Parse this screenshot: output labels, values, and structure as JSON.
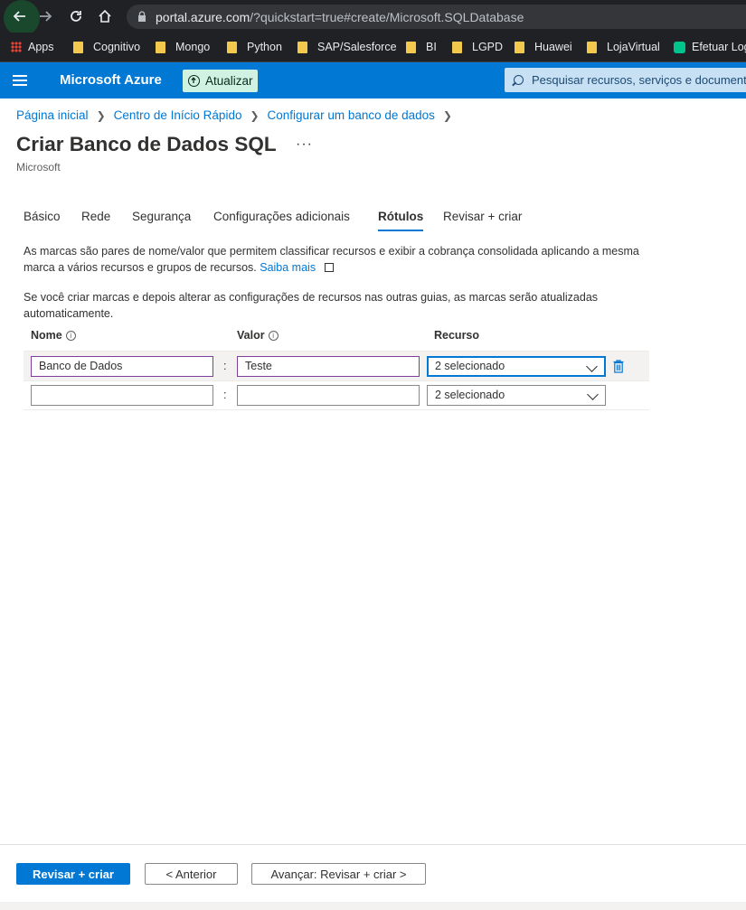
{
  "browser": {
    "url_domain": "portal.azure.com",
    "url_path": "/?quickstart=true#create/Microsoft.SQLDatabase",
    "bookmarks": [
      "Apps",
      "Cognitivo",
      "Mongo",
      "Python",
      "SAP/Salesforce",
      "BI",
      "LGPD",
      "Huawei",
      "LojaVirtual",
      "Efetuar Log"
    ]
  },
  "header": {
    "brand": "Microsoft Azure",
    "update_label": "Atualizar",
    "search_placeholder": "Pesquisar recursos, serviços e documentos"
  },
  "breadcrumb": [
    "Página inicial",
    "Centro de Início Rápido",
    "Configurar um banco de dados"
  ],
  "page": {
    "title": "Criar Banco de Dados SQL",
    "more": "···",
    "subtitle": "Microsoft"
  },
  "tabs": [
    {
      "label": "Básico",
      "active": false
    },
    {
      "label": "Rede",
      "active": false
    },
    {
      "label": "Segurança",
      "active": false
    },
    {
      "label": "Configurações adicionais",
      "active": false
    },
    {
      "label": "Rótulos",
      "active": true
    },
    {
      "label": "Revisar + criar",
      "active": false
    }
  ],
  "description": {
    "para1": "As marcas são pares de nome/valor que permitem classificar recursos e exibir a cobrança consolidada aplicando a mesma marca a vários recursos e grupos de recursos.",
    "learn_more": "Saiba mais",
    "para2": "Se você criar marcas e depois alterar as configurações de recursos nas outras guias, as marcas serão atualizadas automaticamente."
  },
  "tag_table": {
    "headers": {
      "name": "Nome",
      "value": "Valor",
      "resource": "Recurso"
    },
    "separator": ":",
    "rows": [
      {
        "name": "Banco de Dados",
        "value": "Teste",
        "resource": "2 selecionado"
      },
      {
        "name": "",
        "value": "",
        "resource": "2 selecionado"
      }
    ]
  },
  "footer": {
    "review_create": "Revisar + criar",
    "previous": "< Anterior",
    "next": "Avançar: Revisar + criar >"
  },
  "colors": {
    "azure_blue": "#0078d4",
    "update_bg": "#cff2e3",
    "input_focus": "#7f3f98"
  }
}
